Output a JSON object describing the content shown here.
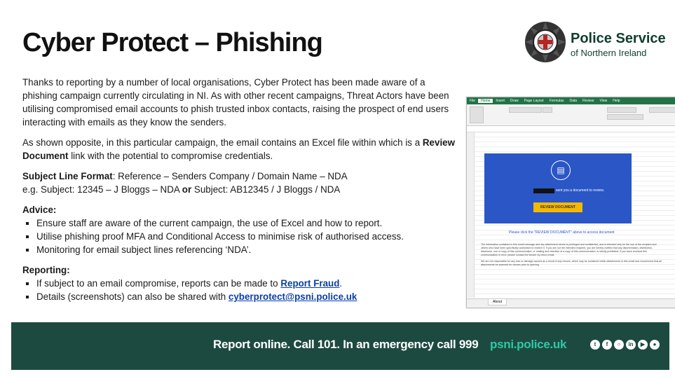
{
  "title": "Cyber Protect – Phishing",
  "logo": {
    "line1": "Police Service",
    "line2": "of Northern Ireland"
  },
  "intro_paragraph": "Thanks to reporting by a number of local organisations, Cyber Protect has been made aware of a phishing campaign currently circulating in NI. As with other recent campaigns, Threat Actors have been utilising compromised email accounts to phish trusted inbox contacts, raising the prospect of end users interacting with emails as they know the senders.",
  "second_paragraph": {
    "prefix": "As shown opposite, in this particular campaign, the email contains an Excel file within which is a ",
    "bold": "Review Document",
    "suffix": " link with the potential to compromise credentials."
  },
  "subject_line": {
    "label": "Subject Line Format",
    "format": ": Reference – Senders Company / Domain Name – NDA",
    "example_prefix": "e.g. Subject: 12345 – J Bloggs – NDA ",
    "example_or": "or",
    "example_suffix": " Subject: AB12345 / J Bloggs / NDA"
  },
  "advice": {
    "heading": "Advice:",
    "items": [
      "Ensure staff are aware of the current campaign, the use of Excel and how to report.",
      "Utilise phishing proof MFA and Conditional Access to minimise risk of authorised access.",
      "Monitoring for email subject lines referencing ‘NDA’."
    ]
  },
  "reporting": {
    "heading": "Reporting:",
    "item1_prefix": "If subject to an email compromise, reports can be made to ",
    "item1_link": "Report Fraud",
    "item1_suffix": ".",
    "item2_prefix": "Details (screenshots) can also be shared with ",
    "item2_link": "cyberprotect@psni.police.uk"
  },
  "excel": {
    "tabs": [
      "File",
      "Home",
      "Insert",
      "Draw",
      "Page Layout",
      "Formulas",
      "Data",
      "Review",
      "View",
      "Help"
    ],
    "sent_text": "sent you a document to review.",
    "button_label": "REVIEW DOCUMENT",
    "please_text": "Please click the \"REVIEW DOCUMENT\" above to access document",
    "fine_print_1": "The information contained in this email message and any attachment hereto is privileged and confidential, and is intended only for the use of the recipient and others who have been specifically authorised to receive it. If you are not the intended recipient, you are hereby notified that any dissemination, distribution, disclosure, use or copy of this communication, or making and retention of a copy of this communication, is strictly prohibited. If you have received this communication in error, please contact the sender by return email.",
    "fine_print_2": "We are not responsible for any loss or damage caused as a result of any viruses, which may be contained within attachments to this email and recommend that all attachments be scanned for viruses prior to opening.",
    "sheet_tab": "About"
  },
  "footer": {
    "text": "Report online. Call 101. In an emergency call 999",
    "url": "psni.police.uk",
    "social_icons": [
      "twitter-icon",
      "facebook-icon",
      "instagram-icon",
      "linkedin-icon",
      "youtube-icon",
      "snapchat-icon"
    ]
  },
  "colors": {
    "footer_bg": "#1d4a40",
    "footer_url": "#2ec8a6",
    "logo_green": "#0f3d2e",
    "link_blue": "#0b3ea8",
    "excel_green": "#217346",
    "email_blue": "#2a56c6",
    "button_yellow": "#f5b800"
  }
}
